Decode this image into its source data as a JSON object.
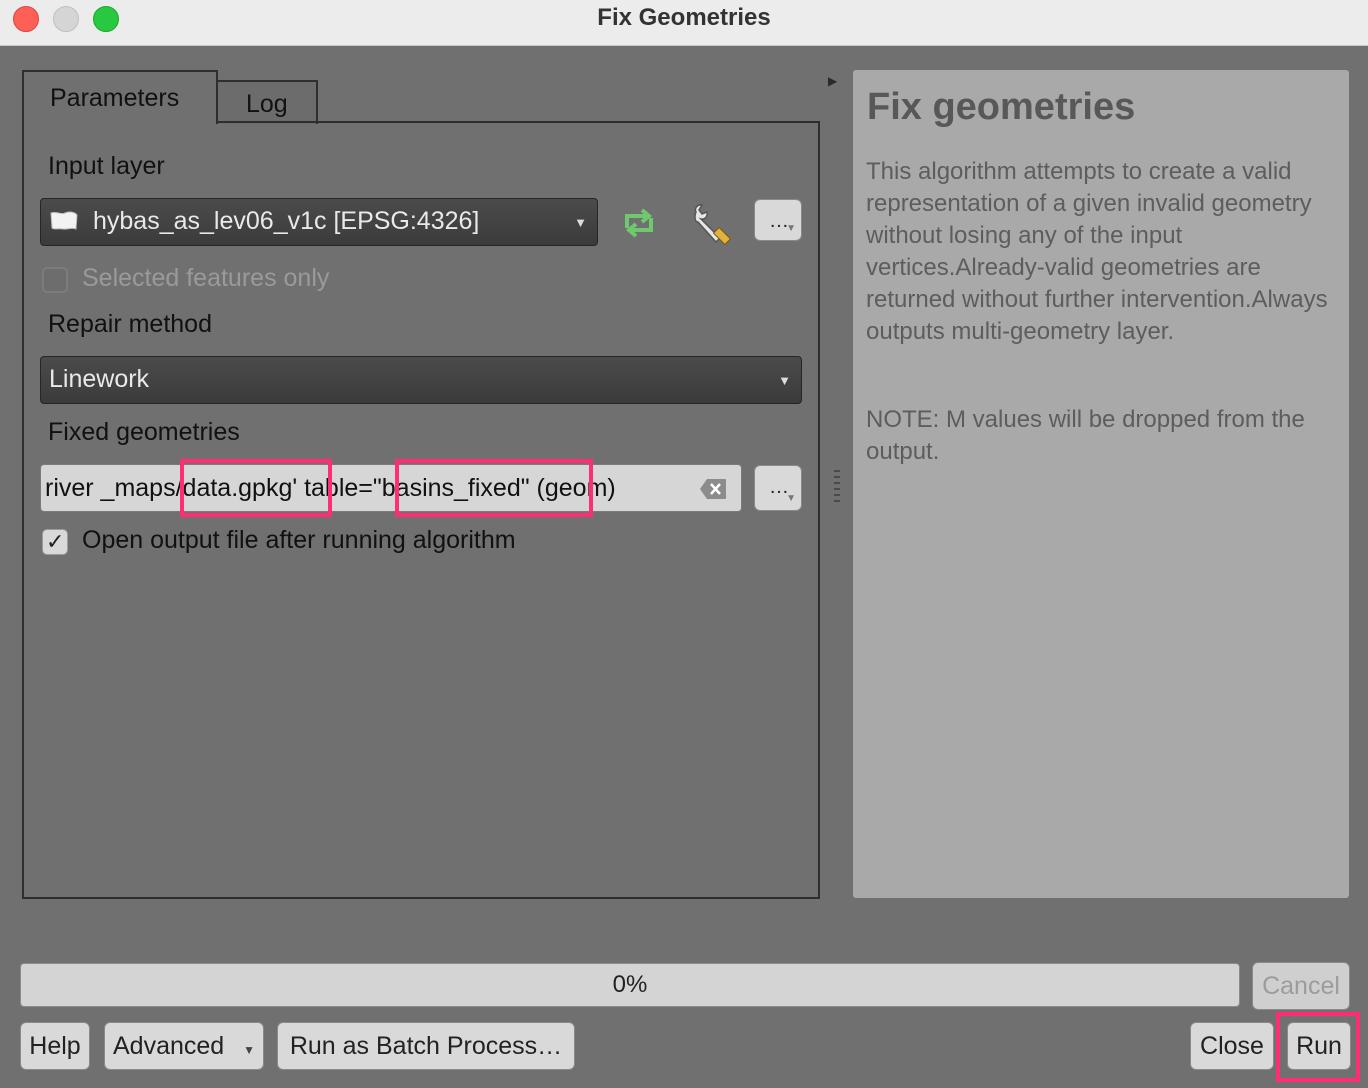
{
  "window": {
    "title": "Fix Geometries",
    "traffic_lights": [
      "close",
      "minimize",
      "maximize"
    ]
  },
  "tabs": [
    {
      "label": "Parameters",
      "active": true
    },
    {
      "label": "Log",
      "active": false
    }
  ],
  "params": {
    "input_layer_label": "Input layer",
    "input_layer_value": "hybas_as_lev06_v1c [EPSG:4326]",
    "input_more_label": "…",
    "selected_only_label": "Selected features only",
    "selected_only_checked": false,
    "repair_method_label": "Repair method",
    "repair_method_value": "Linework",
    "fixed_geom_label": "Fixed geometries",
    "fixed_geom_value": "river _maps/data.gpkg' table=\"basins_fixed\" (geom)",
    "output_more_label": "…",
    "open_output_label": "Open output file after running algorithm",
    "open_output_checked": true,
    "check_glyph": "✓"
  },
  "help": {
    "title": "Fix geometries",
    "description": "This algorithm attempts to create a valid representation of a given invalid geometry without losing any of the input vertices.Already-valid geometries are returned without further intervention.Always outputs multi-geometry layer.",
    "note": "NOTE: M values will be dropped from the output."
  },
  "progress": {
    "percent": 0,
    "text": "0%"
  },
  "buttons": {
    "cancel": "Cancel",
    "help": "Help",
    "advanced": "Advanced",
    "batch": "Run as Batch Process…",
    "close": "Close",
    "run": "Run"
  },
  "highlight_color": "#ff2d72",
  "icons": {
    "iterate": "iterate-icon",
    "wrench": "wrench-icon",
    "layer": "polygon-layer-icon",
    "clear": "clear-icon"
  }
}
